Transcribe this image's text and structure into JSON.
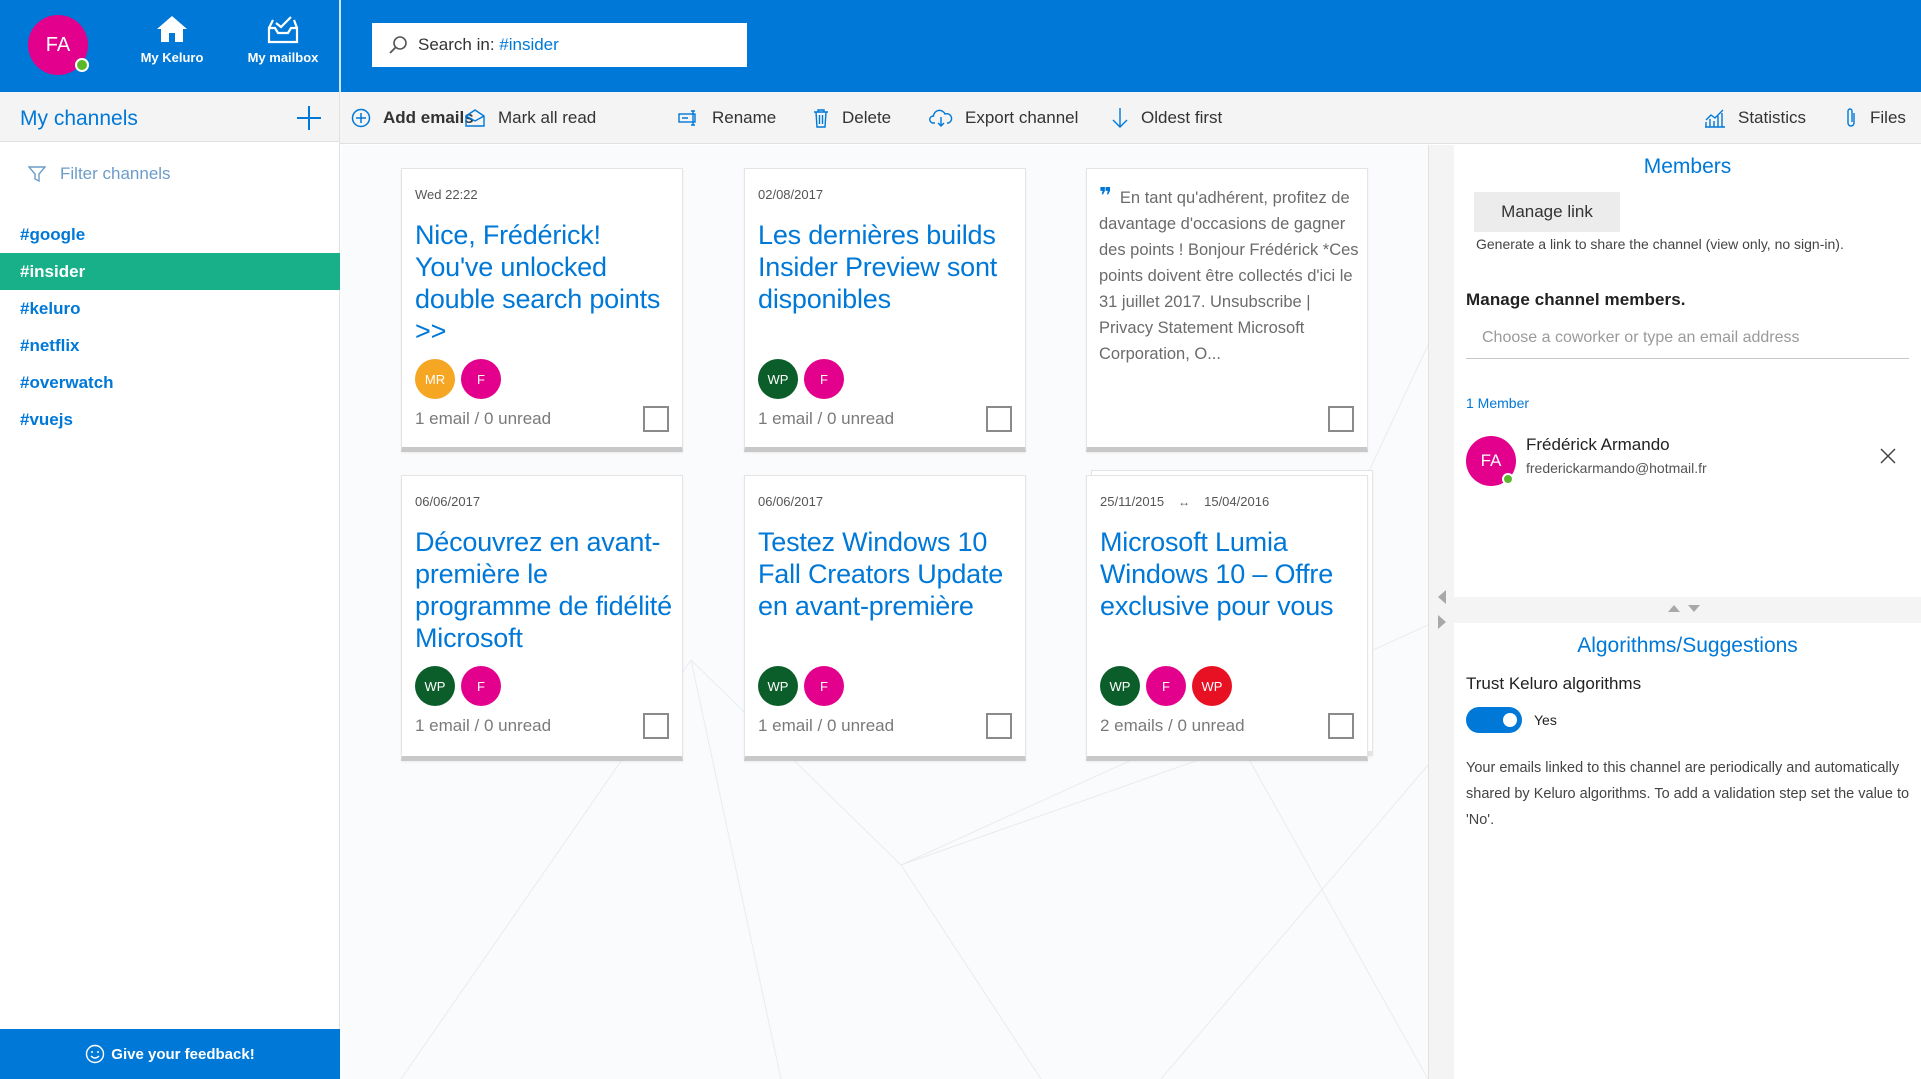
{
  "user": {
    "initials": "FA"
  },
  "topnav": {
    "home_label": "My Keluro",
    "mailbox_label": "My mailbox"
  },
  "search": {
    "prefix": "Search in: ",
    "scope": "#insider"
  },
  "sidebar": {
    "title": "My channels",
    "filter_placeholder": "Filter channels",
    "channels": [
      "#google",
      "#insider",
      "#keluro",
      "#netflix",
      "#overwatch",
      "#vuejs"
    ],
    "active_channel": "#insider",
    "feedback_label": "Give your feedback!"
  },
  "toolbar": {
    "add_emails": "Add emails",
    "mark_all_read": "Mark all read",
    "rename": "Rename",
    "delete": "Delete",
    "export_channel": "Export channel",
    "oldest_first": "Oldest first",
    "statistics": "Statistics",
    "files": "Files"
  },
  "cards": [
    {
      "date": "Wed 22:22",
      "title": "Nice, Frédérick! You've unlocked double search points >>",
      "avatars": [
        {
          "t": "MR",
          "c": "#f5a623"
        },
        {
          "t": "F",
          "c": "#e3008c"
        }
      ],
      "count": "1 email / 0 unread"
    },
    {
      "date": "02/08/2017",
      "title": "Les dernières builds Insider Preview sont disponibles",
      "avatars": [
        {
          "t": "WP",
          "c": "#0b5e2a"
        },
        {
          "t": "F",
          "c": "#e3008c"
        }
      ],
      "count": "1 email / 0 unread"
    },
    {
      "quote": "En tant qu'adhérent, profitez de davantage d'occasions de gagner des points ! Bonjour Frédérick *Ces points doivent être collectés d'ici le 31 juillet 2017. Unsubscribe | Privacy Statement Microsoft Corporation, O..."
    },
    {
      "date": "06/06/2017",
      "title": "Découvrez en avant-première le programme de fidélité Microsoft",
      "avatars": [
        {
          "t": "WP",
          "c": "#0b5e2a"
        },
        {
          "t": "F",
          "c": "#e3008c"
        }
      ],
      "count": "1 email / 0 unread"
    },
    {
      "date": "06/06/2017",
      "title": "Testez Windows 10 Fall Creators Update en avant-première",
      "avatars": [
        {
          "t": "WP",
          "c": "#0b5e2a"
        },
        {
          "t": "F",
          "c": "#e3008c"
        }
      ],
      "count": "1 email / 0 unread"
    },
    {
      "date": "25/11/2015",
      "date_end": "15/04/2016",
      "title": "Microsoft Lumia Windows 10 – Offre exclusive pour vous",
      "avatars": [
        {
          "t": "WP",
          "c": "#0b5e2a"
        },
        {
          "t": "F",
          "c": "#e3008c"
        },
        {
          "t": "WP",
          "c": "#e81123"
        }
      ],
      "count": "2 emails / 0 unread"
    }
  ],
  "members_panel": {
    "title": "Members",
    "manage_link": "Manage link",
    "share_text": "Generate a link to share the channel (view only, no sign-in).",
    "manage_members": "Manage channel members.",
    "coworker_placeholder": "Choose a coworker or type an email address",
    "member_count": "1 Member",
    "member": {
      "initials": "FA",
      "name": "Frédérick Armando",
      "email": "frederickarmando@hotmail.fr"
    }
  },
  "algo_panel": {
    "title": "Algorithms/Suggestions",
    "trust_label": "Trust Keluro algorithms",
    "toggle_value": "Yes",
    "description": "Your emails linked to this channel are periodically and automatically shared by Keluro algorithms. To add a validation step set the value to 'No'."
  },
  "colors": {
    "brand": "#0078d7",
    "active_channel": "#17b089",
    "pink_avatar": "#e3008c"
  }
}
